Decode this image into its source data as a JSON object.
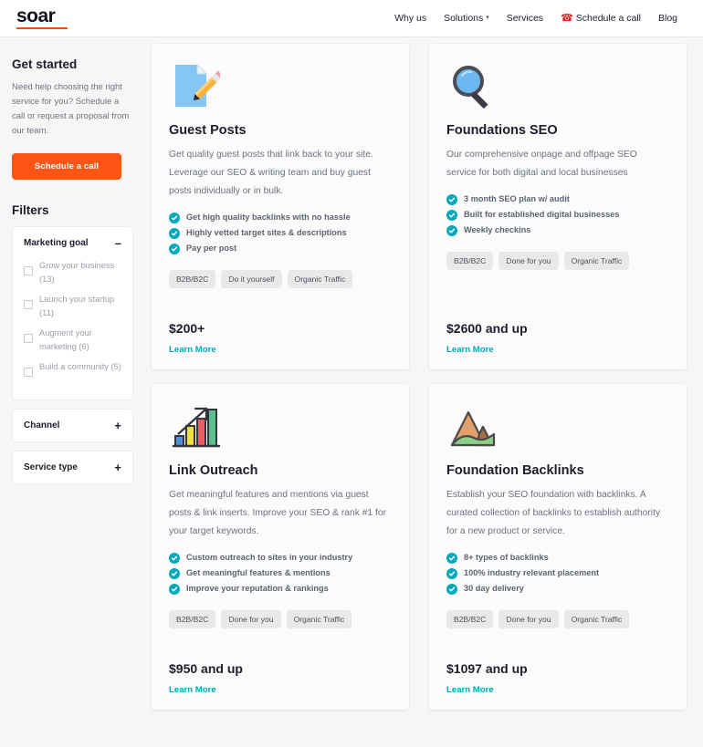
{
  "header": {
    "logo_text": "soar",
    "accent_color": "#ff4d00",
    "nav": [
      {
        "label": "Why us",
        "icon": "",
        "caret": false
      },
      {
        "label": "Solutions",
        "icon": "",
        "caret": true
      },
      {
        "label": "Services",
        "icon": "",
        "caret": false
      },
      {
        "label": "Schedule a call",
        "icon": "phone-icon",
        "caret": false
      },
      {
        "label": "Blog",
        "icon": "",
        "caret": false
      }
    ]
  },
  "sidebar": {
    "get_started_title": "Get started",
    "get_started_desc": "Need help choosing the right service for you? Schedule a call or request a proposal from our team.",
    "cta_label": "Schedule a call",
    "cta_color": "#ff5514",
    "filters_title": "Filters",
    "filter_groups": [
      {
        "label": "Marketing goal",
        "sign": "–",
        "expanded": true,
        "options": [
          {
            "label": "Grow your business (13)",
            "checked": false
          },
          {
            "label": "Launch your startup (11)",
            "checked": false
          },
          {
            "label": "Augment your marketing (6)",
            "checked": false
          },
          {
            "label": "Build a community (5)",
            "checked": false
          }
        ]
      },
      {
        "label": "Channel",
        "sign": "+",
        "expanded": false,
        "options": []
      },
      {
        "label": "Service type",
        "sign": "+",
        "expanded": false,
        "options": []
      }
    ]
  },
  "cards": [
    {
      "icon": "document-pencil-icon",
      "title": "Guest Posts",
      "description": "Get quality guest posts that link back to your site. Leverage our SEO & writing team and buy guest posts individually or in bulk.",
      "features": [
        "Get high quality backlinks with no hassle",
        "Highly vetted target sites & descriptions",
        "Pay per post"
      ],
      "tags": [
        "B2B/B2C",
        "Do it yourself",
        "Organic Traffic"
      ],
      "price": "$200+",
      "link_label": "Learn More"
    },
    {
      "icon": "magnifying-glass-icon",
      "title": "Foundations SEO",
      "description": "Our comprehensive onpage and offpage SEO service for both digital and local businesses",
      "features": [
        "3 month SEO plan w/ audit",
        "Built for established digital businesses",
        "Weekly checkins"
      ],
      "tags": [
        "B2B/B2C",
        "Done for you",
        "Organic Traffic"
      ],
      "price": "$2600 and up",
      "link_label": "Learn More"
    },
    {
      "icon": "bar-chart-growth-icon",
      "title": "Link Outreach",
      "description": "Get meaningful features and mentions via guest posts & link inserts. Improve your SEO & rank #1 for your target keywords.",
      "features": [
        "Custom outreach to sites in your industry",
        "Get meaningful features & mentions",
        "Improve your reputation & rankings"
      ],
      "tags": [
        "B2B/B2C",
        "Done for you",
        "Organic Traffic"
      ],
      "price": "$950 and up",
      "link_label": "Learn More"
    },
    {
      "icon": "mountain-icon",
      "title": "Foundation Backlinks",
      "description": "Establish your SEO foundation with backlinks. A curated collection of backlinks to establish authority for a new product or service.",
      "features": [
        "8+ types of backlinks",
        "100% industry relevant placement",
        "30 day delivery"
      ],
      "tags": [
        "B2B/B2C",
        "Done for you",
        "Organic Traffic"
      ],
      "price": "$1097 and up",
      "link_label": "Learn More"
    }
  ],
  "colors": {
    "check_teal": "#00a8c0",
    "link_teal": "#00a8c0",
    "tag_bg": "#e9e9e9",
    "page_bg": "#f6f6f6"
  }
}
